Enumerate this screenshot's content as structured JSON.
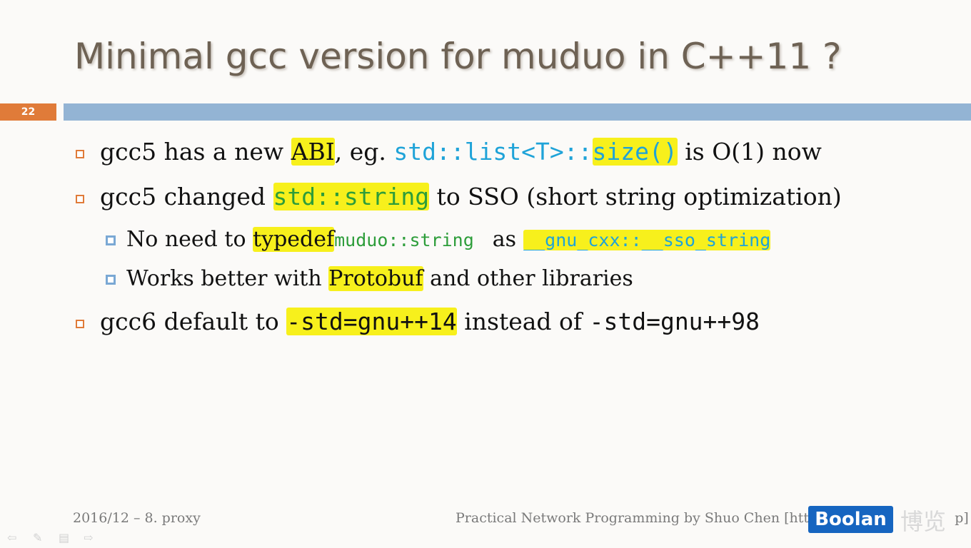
{
  "slide": {
    "title": "Minimal gcc version for muduo in C++11 ?",
    "number": "22"
  },
  "bullets": {
    "b1": {
      "t1": "gcc5 has a new ",
      "t2": "ABI",
      "t3": ", eg. ",
      "c1": "std::list<T>::",
      "c2": "size()",
      "t4": " is O(1) now"
    },
    "b2": {
      "t1": "gcc5 changed ",
      "c1": "std::string",
      "t2": " to SSO (short string optimization)"
    },
    "b2a": {
      "t1": "No need to ",
      "t2": "typedef",
      "c1": "muduo::string",
      "t3": "as",
      "c2": "__gnu_cxx::__sso_string"
    },
    "b2b": {
      "t1": "Works better with ",
      "t2": "Protobuf",
      "t3": " and other libraries"
    },
    "b3": {
      "t1": "gcc6 default to ",
      "c1": "-std=gnu++14",
      "t2": " instead of ",
      "c2": "-std=gnu++98"
    }
  },
  "footer": {
    "left": "2016/12 – 8. proxy",
    "right": "Practical Network Programming by Shuo Chen [http://ch",
    "right_tail": "p]"
  },
  "logo": {
    "text": "Boolan",
    "cn": "博览"
  },
  "nav": {
    "prev": "⇦",
    "pen": "✎",
    "menu": "▤",
    "next": "⇨"
  }
}
